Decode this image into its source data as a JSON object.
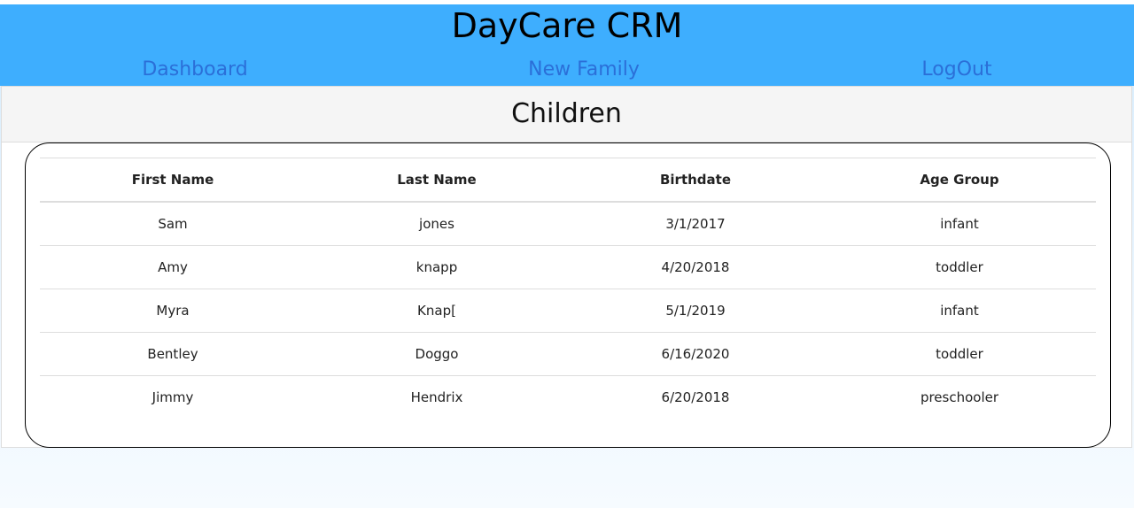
{
  "header": {
    "title": "DayCare CRM",
    "nav": {
      "dashboard": "Dashboard",
      "new_family": "New Family",
      "logout": "LogOut"
    }
  },
  "panel": {
    "title": "Children"
  },
  "table": {
    "columns": [
      "First Name",
      "Last Name",
      "Birthdate",
      "Age Group"
    ],
    "rows": [
      [
        "Sam",
        "jones",
        "3/1/2017",
        "infant"
      ],
      [
        "Amy",
        "knapp",
        "4/20/2018",
        "toddler"
      ],
      [
        "Myra",
        "Knap[",
        "5/1/2019",
        "infant"
      ],
      [
        "Bentley",
        "Doggo",
        "6/16/2020",
        "toddler"
      ],
      [
        "Jimmy",
        "Hendrix",
        "6/20/2018",
        "preschooler"
      ]
    ]
  },
  "colors": {
    "header_bg": "#3eaefe",
    "nav_link": "#2b6fd8",
    "panel_heading_bg": "#f5f5f5"
  }
}
